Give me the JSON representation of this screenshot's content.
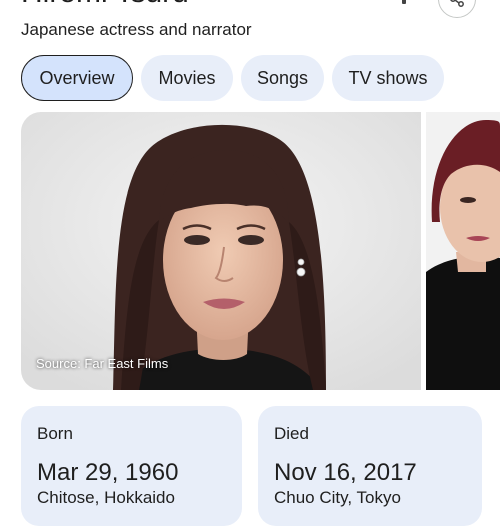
{
  "header": {
    "title": "Hiromi Tsuru",
    "subtitle": "Japanese actress and narrator"
  },
  "tabs": [
    {
      "label": "Overview",
      "active": true
    },
    {
      "label": "Movies",
      "active": false
    },
    {
      "label": "Songs",
      "active": false
    },
    {
      "label": "TV shows",
      "active": false
    }
  ],
  "gallery": {
    "source_label": "Source: Far East Films"
  },
  "cards": {
    "born": {
      "label": "Born",
      "date": "Mar 29, 1960",
      "place": "Chitose, Hokkaido"
    },
    "died": {
      "label": "Died",
      "date": "Nov 16, 2017",
      "place": "Chuo City, Tokyo"
    }
  },
  "colors": {
    "chip_background": "#e8eef9",
    "chip_active_background": "#d4e3fc",
    "card_background": "#e8eef9",
    "text": "#1f1f1f"
  },
  "icons": [
    "share-icon"
  ]
}
